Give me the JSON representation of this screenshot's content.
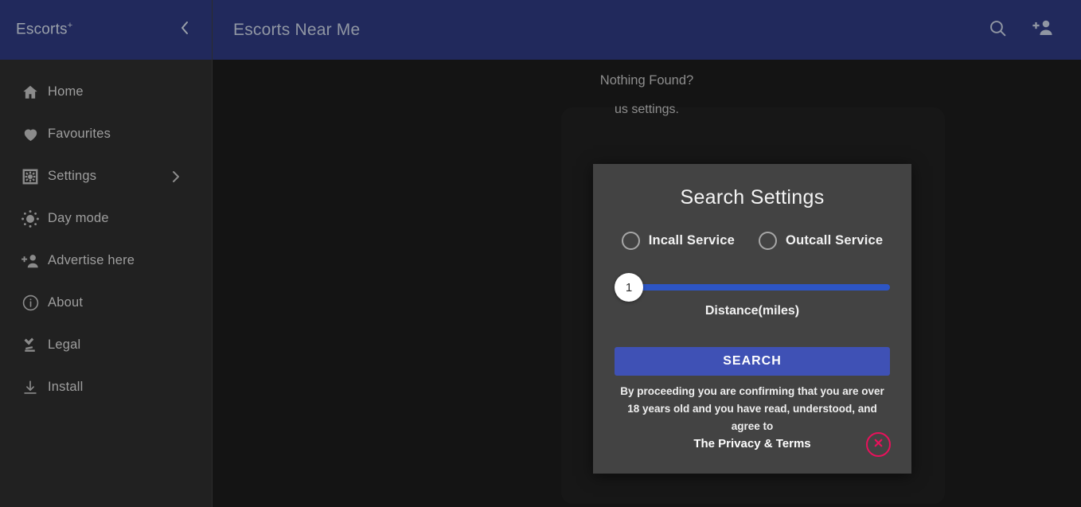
{
  "sidebar": {
    "brand": "Escorts",
    "brand_sup": "+",
    "collapse_icon": "chevron-left-icon",
    "items": [
      {
        "label": "Home",
        "icon": "home-icon"
      },
      {
        "label": "Favourites",
        "icon": "heart-icon"
      },
      {
        "label": "Settings",
        "icon": "gear-icon",
        "chevron": "chevron-right-icon"
      },
      {
        "label": "Day mode",
        "icon": "sun-icon"
      },
      {
        "label": "Advertise here",
        "icon": "person-add-icon"
      },
      {
        "label": "About",
        "icon": "info-circle-icon"
      },
      {
        "label": "Legal",
        "icon": "gavel-icon"
      },
      {
        "label": "Install",
        "icon": "download-icon"
      }
    ]
  },
  "header": {
    "title": "Escorts Near Me",
    "search_icon": "search-icon",
    "add_user_icon": "person-add-icon"
  },
  "content": {
    "empty_title": "Nothing Found?",
    "empty_subtitle": "us settings."
  },
  "modal": {
    "title": "Search Settings",
    "options": [
      {
        "label": "Incall Service",
        "selected": false
      },
      {
        "label": "Outcall Service",
        "selected": false
      }
    ],
    "slider": {
      "value": "1",
      "caption": "Distance(miles)"
    },
    "search_label": "SEARCH",
    "disclaimer": "By proceeding you are confirming that you are over 18 years old and you have read, understood, and agree to",
    "terms_label": "The Privacy & Terms",
    "close_icon": "close-circle-icon"
  },
  "colors": {
    "header_navy": "#21295c",
    "sidebar_bg": "#212121",
    "main_bg": "#141414",
    "modal_bg": "#434343",
    "slider_blue": "#2d55c4",
    "button_indigo": "#3f51b5",
    "close_pink": "#e8115b"
  }
}
